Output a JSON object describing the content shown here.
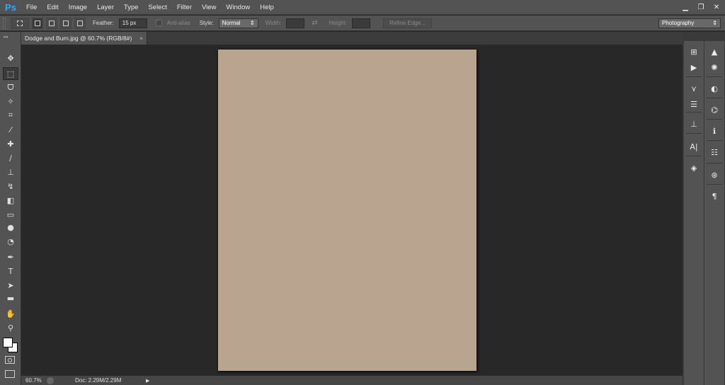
{
  "app": {
    "logo": "Ps"
  },
  "menu": [
    "File",
    "Edit",
    "Image",
    "Layer",
    "Type",
    "Select",
    "Filter",
    "View",
    "Window",
    "Help"
  ],
  "window_controls": {
    "minimize": "▁",
    "restore": "❐",
    "close": "✕"
  },
  "options": {
    "feather_label": "Feather:",
    "feather_value": "15 px",
    "antialias_label": "Anti-alias",
    "style_label": "Style:",
    "style_value": "Normal",
    "width_label": "Width:",
    "height_label": "Height:",
    "refine_edge": "Refine Edge...",
    "workspace": "Photography"
  },
  "document": {
    "tab_title": "Dodge and Burn.jpg @ 60.7% (RGB/8#)",
    "close": "×"
  },
  "status": {
    "zoom": "60.7%",
    "doc": "Doc: 2.29M/2.29M"
  },
  "tools": [
    {
      "name": "move-tool-icon",
      "glyph": "✥"
    },
    {
      "name": "marquee-tool-icon",
      "glyph": "⬚"
    },
    {
      "name": "lasso-tool-icon",
      "glyph": "ᗜ"
    },
    {
      "name": "magic-wand-tool-icon",
      "glyph": "✧"
    },
    {
      "name": "crop-tool-icon",
      "glyph": "⌗"
    },
    {
      "name": "eyedropper-tool-icon",
      "glyph": "⁄"
    },
    {
      "name": "healing-brush-tool-icon",
      "glyph": "✚"
    },
    {
      "name": "brush-tool-icon",
      "glyph": "∕"
    },
    {
      "name": "clone-stamp-tool-icon",
      "glyph": "⊥"
    },
    {
      "name": "history-brush-tool-icon",
      "glyph": "↯"
    },
    {
      "name": "eraser-tool-icon",
      "glyph": "◧"
    },
    {
      "name": "gradient-tool-icon",
      "glyph": "▭"
    },
    {
      "name": "blur-tool-icon",
      "glyph": "●"
    },
    {
      "name": "dodge-tool-icon",
      "glyph": "◔"
    },
    {
      "name": "pen-tool-icon",
      "glyph": "✒"
    },
    {
      "name": "type-tool-icon",
      "glyph": "T"
    },
    {
      "name": "path-selection-tool-icon",
      "glyph": "➤"
    },
    {
      "name": "rectangle-tool-icon",
      "glyph": "▬"
    },
    {
      "name": "hand-tool-icon",
      "glyph": "✋"
    },
    {
      "name": "zoom-tool-icon",
      "glyph": "⚲"
    }
  ],
  "panel_col1": [
    {
      "name": "history-panel-icon",
      "glyph": "⊞"
    },
    {
      "name": "actions-panel-icon",
      "glyph": "▶"
    },
    {
      "name": "brush-panel-icon",
      "glyph": "⋎"
    },
    {
      "name": "brush-presets-panel-icon",
      "glyph": "☰"
    },
    {
      "name": "clone-source-panel-icon",
      "glyph": "⊥"
    },
    {
      "name": "character-panel-icon",
      "glyph": "A|"
    },
    {
      "name": "layers-panel-icon",
      "glyph": "◈"
    }
  ],
  "panel_col2": [
    {
      "name": "histogram-panel-icon",
      "glyph": "▲"
    },
    {
      "name": "navigator-panel-icon",
      "glyph": "✺"
    },
    {
      "name": "adjustments-panel-icon",
      "glyph": "◐"
    },
    {
      "name": "paths-panel-icon",
      "glyph": "⌬"
    },
    {
      "name": "info-panel-icon",
      "glyph": "ℹ"
    },
    {
      "name": "properties-panel-icon",
      "glyph": "☷"
    },
    {
      "name": "channels-panel-icon",
      "glyph": "⊛"
    },
    {
      "name": "paragraph-panel-icon",
      "glyph": "¶"
    }
  ]
}
